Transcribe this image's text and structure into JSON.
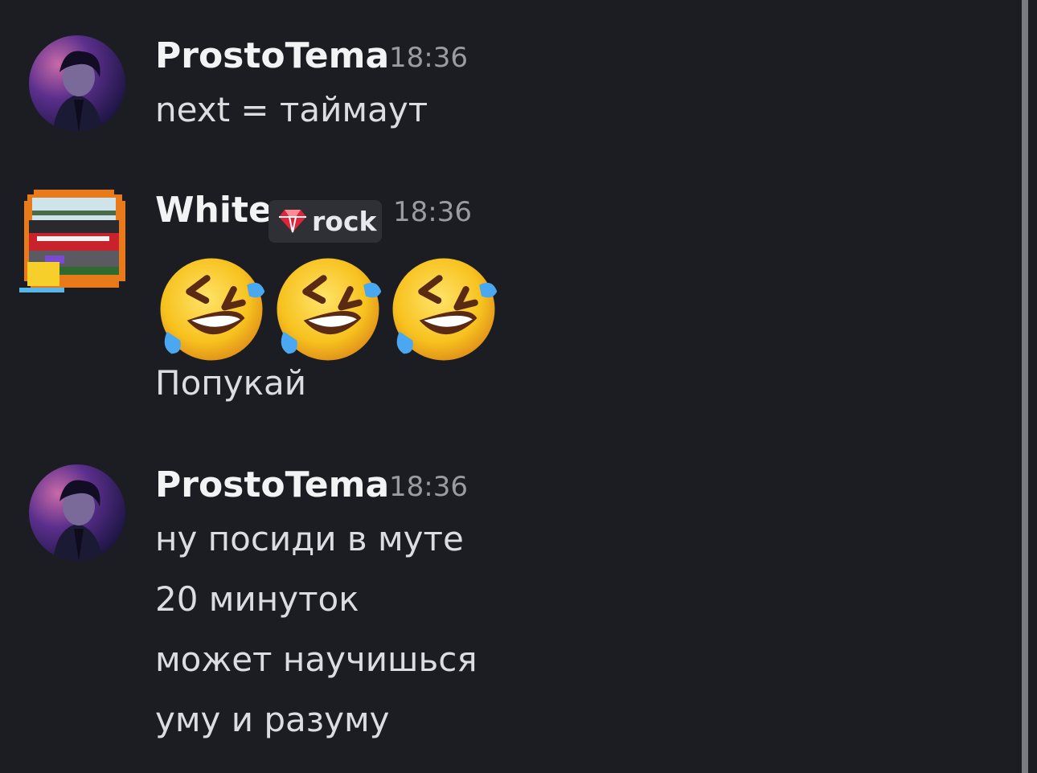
{
  "messages": [
    {
      "author": "ProstoTema",
      "time": "18:36",
      "lines": [
        "next = таймаут"
      ]
    },
    {
      "author": "White",
      "tag": {
        "icon": "gem-icon",
        "label": "rock"
      },
      "time": "18:36",
      "emojis": [
        "rolling-on-floor-laughing",
        "rolling-on-floor-laughing",
        "rolling-on-floor-laughing"
      ],
      "lines": [
        "Попукай"
      ]
    },
    {
      "author": "ProstoTema",
      "time": "18:36",
      "lines": [
        "ну посиди в муте",
        "20 минуток",
        "может научишься",
        "уму и разуму"
      ]
    }
  ]
}
